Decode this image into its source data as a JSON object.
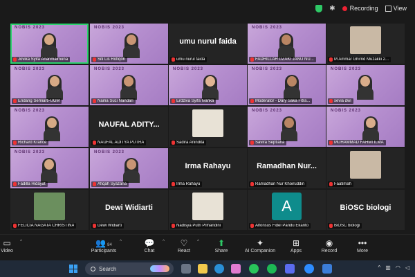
{
  "topbar": {
    "recording_label": "Recording",
    "view_label": "View"
  },
  "conference_banner": "NOBIS 2023",
  "tiles": [
    {
      "name": "Jovika Syifa Ananmaimuna",
      "type": "video",
      "active": true
    },
    {
      "name": "Siti Lis Rofiqoh",
      "type": "video"
    },
    {
      "name": "umu nurul faida",
      "type": "text",
      "display": "umu nurul faida"
    },
    {
      "name": "FADHILLAH DZAKI JANU NU...",
      "type": "video"
    },
    {
      "name": "M Ammar Ghirrid Muzakki 2...",
      "type": "photo"
    },
    {
      "name": "Endang Semiarti-UGM",
      "type": "video"
    },
    {
      "name": "Naina Suci Nandari",
      "type": "video"
    },
    {
      "name": "Erdziva Syifa Ivanka",
      "type": "video"
    },
    {
      "name": "Moderator - Dary Saka Fitra...",
      "type": "video"
    },
    {
      "name": "sevia dwi",
      "type": "video"
    },
    {
      "name": "Richard Krance",
      "type": "video"
    },
    {
      "name": "NAUFAL ADITYA PUTRA",
      "type": "text",
      "display": "NAUFAL ADITY..."
    },
    {
      "name": "Sadira Anindita",
      "type": "photo"
    },
    {
      "name": "Savira Septiana",
      "type": "video"
    },
    {
      "name": "MUHAMMAD FAHMI ILMA",
      "type": "video"
    },
    {
      "name": "Fadilla Hidayat",
      "type": "video"
    },
    {
      "name": "Afiqah Syazana",
      "type": "video"
    },
    {
      "name": "Irma Rahayu",
      "type": "text",
      "display": "Irma Rahayu"
    },
    {
      "name": "Ramadhan Nur Khoiruddin",
      "type": "text",
      "display": "Ramadhan Nur..."
    },
    {
      "name": "Faatimah",
      "type": "photo"
    },
    {
      "name": "FELICIA NAGATA CHRISTINA",
      "type": "photo"
    },
    {
      "name": "Dewi Widiarti",
      "type": "text",
      "display": "Dewi Widiarti"
    },
    {
      "name": "Nadisya Putri Prihandini",
      "type": "photo"
    },
    {
      "name": "Alfonsus Fidel Pandu Ekanto",
      "type": "avatar",
      "letter": "A"
    },
    {
      "name": "BiOSC biologi",
      "type": "text",
      "display": "BiOSC biologi"
    }
  ],
  "toolbar": {
    "video": "Video",
    "participants": "Participants",
    "participants_count": "84",
    "chat": "Chat",
    "react": "React",
    "share": "Share",
    "ai_companion": "AI Companion",
    "apps": "Apps",
    "record": "Record",
    "more": "More"
  },
  "taskbar": {
    "search_placeholder": "Search"
  },
  "colors": {
    "tile_purple": "#b68fcf",
    "active_border": "#2dd36f",
    "share_green": "#2ec866",
    "record_red": "#e23333",
    "avatar_teal": "#0e8c8c"
  }
}
